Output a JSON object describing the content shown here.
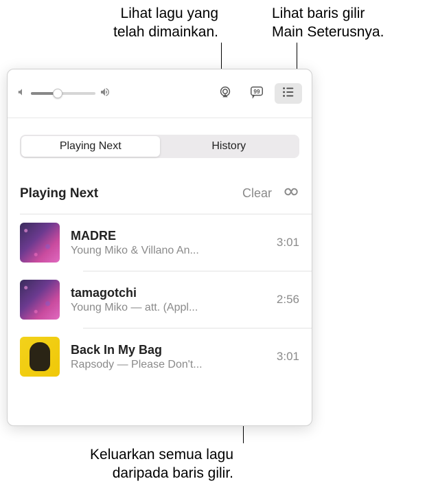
{
  "callouts": {
    "history": "Lihat lagu yang\ntelah dimainkan.",
    "queue_button": "Lihat baris gilir\nMain Seterusnya.",
    "clear": "Keluarkan semua lagu\ndaripada baris gilir."
  },
  "toolbar": {
    "volume_percent": 42
  },
  "tabs": {
    "playing_next": "Playing Next",
    "history": "History"
  },
  "section": {
    "title": "Playing Next",
    "clear_label": "Clear"
  },
  "tracks": [
    {
      "title": "MADRE",
      "artist": "Young Miko & Villano An...",
      "duration": "3:01",
      "art": "purple"
    },
    {
      "title": "tamagotchi",
      "artist": "Young Miko — att. (Appl...",
      "duration": "2:56",
      "art": "purple"
    },
    {
      "title": "Back In My Bag",
      "artist": "Rapsody — Please Don't...",
      "duration": "3:01",
      "art": "yellow"
    }
  ]
}
